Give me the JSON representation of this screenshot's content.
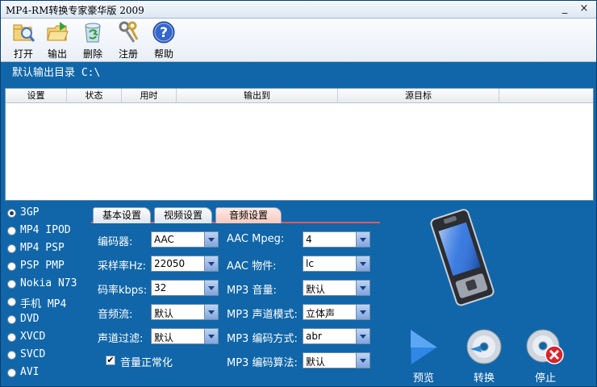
{
  "window": {
    "title": "MP4-RM转换专家豪华版 2009",
    "minimize": "_",
    "close": "×"
  },
  "toolbar": [
    {
      "label": "打开",
      "icon": "open-folder-icon"
    },
    {
      "label": "输出",
      "icon": "output-folder-icon"
    },
    {
      "label": "删除",
      "icon": "recycle-bin-icon"
    },
    {
      "label": "注册",
      "icon": "keys-icon"
    },
    {
      "label": "帮助",
      "icon": "help-icon"
    }
  ],
  "output_dir": "默认输出目录 C:\\",
  "table": {
    "columns": [
      "设置",
      "状态",
      "用时",
      "输出到",
      "源目标"
    ]
  },
  "formats": [
    "3GP",
    "MP4 IPOD",
    "MP4 PSP",
    "PSP PMP",
    "Nokia N73",
    "手机 MP4",
    "DVD",
    "XVCD",
    "SVCD",
    "AVI"
  ],
  "selected_format": "3GP",
  "tabs": [
    "基本设置",
    "视频设置",
    "音频设置"
  ],
  "active_tab": "音频设置",
  "left_settings": [
    {
      "label": "编码器:",
      "value": "AAC"
    },
    {
      "label": "采样率Hz:",
      "value": "22050"
    },
    {
      "label": "码率kbps:",
      "value": "32"
    },
    {
      "label": "音频流:",
      "value": "默认"
    },
    {
      "label": "声道过滤:",
      "value": "默认"
    }
  ],
  "right_settings": [
    {
      "label": "AAC Mpeg:",
      "value": "4"
    },
    {
      "label": "AAC 物件:",
      "value": "lc"
    },
    {
      "label": "MP3 音量:",
      "value": "默认"
    },
    {
      "label": "MP3 声道模式:",
      "value": "立体声"
    },
    {
      "label": "MP3 编码方式:",
      "value": "abr"
    },
    {
      "label": "MP3 编码算法:",
      "value": "默认"
    }
  ],
  "normalize": {
    "label": "音量正常化",
    "checked": true
  },
  "actions": {
    "preview": "预览",
    "convert": "转换",
    "stop": "停止"
  },
  "colors": {
    "background": "#1066a8",
    "tab_underline": "#e65a5a"
  }
}
